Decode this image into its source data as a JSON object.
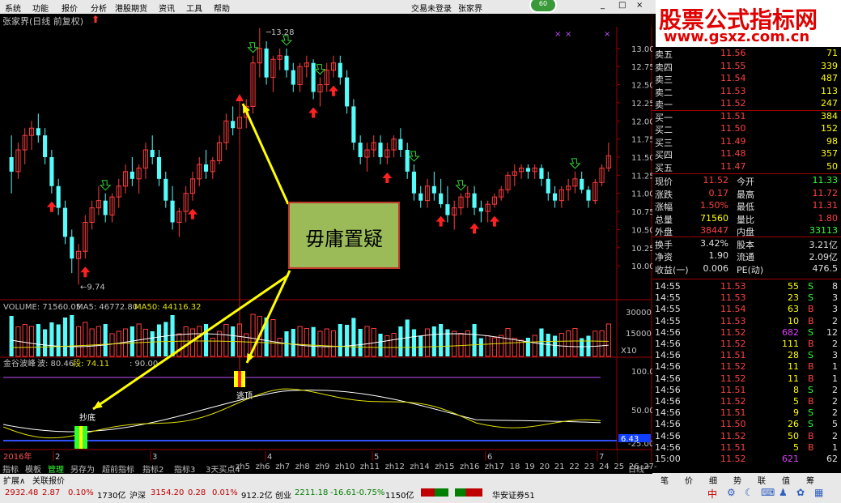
{
  "menu": [
    "系统",
    "功能",
    "报价",
    "分析",
    "港股期货",
    "资讯",
    "工具",
    "帮助"
  ],
  "top_status": {
    "trading": "交易未登录",
    "stock": "张家界",
    "badge": "60"
  },
  "window_buttons": [
    "_",
    "□",
    "×"
  ],
  "title": "张家界(日线 前复权)",
  "chart_data": {
    "type": "candlestick",
    "price_axis": {
      "ticks": [
        "13.00",
        "12.75",
        "12.50",
        "12.25",
        "12.00",
        "11.75",
        "11.50",
        "11.25",
        "11.00",
        "10.75",
        "10.50",
        "10.25",
        "10.00"
      ],
      "ylim": [
        9.7,
        13.3
      ]
    },
    "high_label": "13.28",
    "low_label": "9.74",
    "candles": [
      [
        11.5,
        11.8,
        11.0,
        11.3
      ],
      [
        11.3,
        11.7,
        11.2,
        11.6
      ],
      [
        11.6,
        11.9,
        11.4,
        11.8
      ],
      [
        11.8,
        12.0,
        11.6,
        11.9
      ],
      [
        11.9,
        12.1,
        11.7,
        11.8
      ],
      [
        11.8,
        11.9,
        11.4,
        11.5
      ],
      [
        11.5,
        11.6,
        11.0,
        11.1
      ],
      [
        11.1,
        11.2,
        10.7,
        10.8
      ],
      [
        10.8,
        10.9,
        10.3,
        10.4
      ],
      [
        10.4,
        10.5,
        9.9,
        10.1
      ],
      [
        10.1,
        10.3,
        9.74,
        10.2
      ],
      [
        10.2,
        10.7,
        10.1,
        10.6
      ],
      [
        10.6,
        10.9,
        10.5,
        10.8
      ],
      [
        10.8,
        11.1,
        10.7,
        10.9
      ],
      [
        10.9,
        11.0,
        10.6,
        10.7
      ],
      [
        10.7,
        11.0,
        10.6,
        10.95
      ],
      [
        10.95,
        11.2,
        10.8,
        11.1
      ],
      [
        11.1,
        11.4,
        11.0,
        11.3
      ],
      [
        11.3,
        11.5,
        11.1,
        11.2
      ],
      [
        11.2,
        11.4,
        11.0,
        11.35
      ],
      [
        11.35,
        11.7,
        11.2,
        11.6
      ],
      [
        11.6,
        11.8,
        11.4,
        11.5
      ],
      [
        11.5,
        11.6,
        11.1,
        11.2
      ],
      [
        11.2,
        11.3,
        10.8,
        10.9
      ],
      [
        10.9,
        11.1,
        10.5,
        10.6
      ],
      [
        10.6,
        10.8,
        10.4,
        10.75
      ],
      [
        10.75,
        11.1,
        10.6,
        11.0
      ],
      [
        11.0,
        11.3,
        10.9,
        11.2
      ],
      [
        11.2,
        11.5,
        11.1,
        11.4
      ],
      [
        11.4,
        11.6,
        11.2,
        11.3
      ],
      [
        11.3,
        11.5,
        11.2,
        11.45
      ],
      [
        11.45,
        11.8,
        11.4,
        11.7
      ],
      [
        11.7,
        12.1,
        11.6,
        12.0
      ],
      [
        12.0,
        12.2,
        11.8,
        11.9
      ],
      [
        11.9,
        12.1,
        11.7,
        12.05
      ],
      [
        12.05,
        12.3,
        11.9,
        12.2
      ],
      [
        12.2,
        12.9,
        12.1,
        12.8
      ],
      [
        12.8,
        13.28,
        12.6,
        13.0
      ],
      [
        13.0,
        13.1,
        12.5,
        12.6
      ],
      [
        12.6,
        12.9,
        12.4,
        12.85
      ],
      [
        12.85,
        13.0,
        12.7,
        12.9
      ],
      [
        12.9,
        13.0,
        12.6,
        12.7
      ],
      [
        12.7,
        12.8,
        12.4,
        12.5
      ],
      [
        12.5,
        12.8,
        12.4,
        12.75
      ],
      [
        12.75,
        12.9,
        12.6,
        12.8
      ],
      [
        12.8,
        12.85,
        12.3,
        12.4
      ],
      [
        12.4,
        12.6,
        12.2,
        12.5
      ],
      [
        12.5,
        12.8,
        12.4,
        12.7
      ],
      [
        12.7,
        12.9,
        12.6,
        12.8
      ],
      [
        12.8,
        12.9,
        12.5,
        12.6
      ],
      [
        12.6,
        12.7,
        12.1,
        12.2
      ],
      [
        12.2,
        12.3,
        11.6,
        11.7
      ],
      [
        11.7,
        11.8,
        11.4,
        11.5
      ],
      [
        11.5,
        11.7,
        11.3,
        11.6
      ],
      [
        11.6,
        11.8,
        11.5,
        11.7
      ],
      [
        11.7,
        11.8,
        11.4,
        11.5
      ],
      [
        11.5,
        11.7,
        11.4,
        11.6
      ],
      [
        11.6,
        11.8,
        11.5,
        11.75
      ],
      [
        11.75,
        11.9,
        11.5,
        11.6
      ],
      [
        11.6,
        11.7,
        11.2,
        11.3
      ],
      [
        11.3,
        11.4,
        10.9,
        11.0
      ],
      [
        11.0,
        11.1,
        10.8,
        10.9
      ],
      [
        10.9,
        11.2,
        10.8,
        11.1
      ],
      [
        11.1,
        11.3,
        10.9,
        11.0
      ],
      [
        11.0,
        11.2,
        10.8,
        10.85
      ],
      [
        10.85,
        11.1,
        10.6,
        10.7
      ],
      [
        10.7,
        10.9,
        10.5,
        10.8
      ],
      [
        10.8,
        11.0,
        10.7,
        10.95
      ],
      [
        10.95,
        11.1,
        10.8,
        11.0
      ],
      [
        11.0,
        11.1,
        10.7,
        10.8
      ],
      [
        10.8,
        10.9,
        10.6,
        10.75
      ],
      [
        10.75,
        10.9,
        10.6,
        10.85
      ],
      [
        10.85,
        11.0,
        10.8,
        10.95
      ],
      [
        10.95,
        11.1,
        10.9,
        11.05
      ],
      [
        11.05,
        11.3,
        11.0,
        11.25
      ],
      [
        11.25,
        11.4,
        11.1,
        11.3
      ],
      [
        11.3,
        11.4,
        11.2,
        11.35
      ],
      [
        11.35,
        11.4,
        11.2,
        11.3
      ],
      [
        11.3,
        11.4,
        11.2,
        11.35
      ],
      [
        11.35,
        11.4,
        11.1,
        11.2
      ],
      [
        11.2,
        11.3,
        10.9,
        11.0
      ],
      [
        11.0,
        11.1,
        10.8,
        10.9
      ],
      [
        10.9,
        11.1,
        10.8,
        11.05
      ],
      [
        11.05,
        11.2,
        10.9,
        11.1
      ],
      [
        11.1,
        11.3,
        11.0,
        11.2
      ],
      [
        11.2,
        11.3,
        11.0,
        11.05
      ],
      [
        11.05,
        11.1,
        10.8,
        10.9
      ],
      [
        10.9,
        11.2,
        10.85,
        11.15
      ],
      [
        11.15,
        11.4,
        11.1,
        11.35
      ],
      [
        11.35,
        11.7,
        11.3,
        11.52
      ]
    ],
    "buy_arrow_idx": [
      6,
      11,
      27,
      45,
      48,
      56,
      64,
      69,
      72
    ],
    "sell_mark_idx": [
      14,
      36,
      41,
      46,
      60,
      67,
      84
    ],
    "volume": {
      "label": "VOLUME: 71560.05",
      "ma5": "MA5: 46772.80",
      "ma50": "MA50: 44116.32",
      "ticks": [
        "30000",
        "15000"
      ],
      "unit": "X10"
    },
    "indicator": {
      "name": "金谷波峰",
      "bo": "波: 80.46",
      "duan": "段: 74.11",
      "v90": ": 90.00",
      "ticks": [
        "100.0",
        "50.00",
        "-25.00"
      ],
      "ref_value": "6.43",
      "bottom_label": "抄底",
      "top_label": "逃顶"
    },
    "date_axis": [
      "2016年",
      "2",
      "3",
      "4",
      "5",
      "6",
      "7"
    ]
  },
  "callout": "毋庸置疑",
  "watermark": {
    "title": "股票公式指标网",
    "url": "www.gsxz.com.cn"
  },
  "order_book": [
    {
      "label": "卖五",
      "price": "11.56",
      "vol": "71"
    },
    {
      "label": "卖四",
      "price": "11.55",
      "vol": "339"
    },
    {
      "label": "卖三",
      "price": "11.54",
      "vol": "487"
    },
    {
      "label": "卖二",
      "price": "11.53",
      "vol": "113"
    },
    {
      "label": "卖一",
      "price": "11.52",
      "vol": "247"
    },
    {
      "label": "买一",
      "price": "11.51",
      "vol": "384"
    },
    {
      "label": "买二",
      "price": "11.50",
      "vol": "152"
    },
    {
      "label": "买三",
      "price": "11.49",
      "vol": "98"
    },
    {
      "label": "买四",
      "price": "11.48",
      "vol": "357"
    },
    {
      "label": "买五",
      "price": "11.47",
      "vol": "50"
    }
  ],
  "stats": [
    {
      "k1": "现价",
      "v1": "11.52",
      "k2": "今开",
      "v2": "11.33"
    },
    {
      "k1": "涨跌",
      "v1": "0.17",
      "k2": "最高",
      "v2": "11.72"
    },
    {
      "k1": "涨幅",
      "v1": "1.50%",
      "k2": "最低",
      "v2": "11.31"
    },
    {
      "k1": "总量",
      "v1": "71560",
      "k2": "量比",
      "v2": "1.80"
    },
    {
      "k1": "外盘",
      "v1": "38447",
      "k2": "内盘",
      "v2": "33113"
    },
    {
      "k1": "换手",
      "v1": "3.42%",
      "k2": "股本",
      "v2": "3.21亿"
    },
    {
      "k1": "净资",
      "v1": "1.90",
      "k2": "流通",
      "v2": "2.09亿"
    },
    {
      "k1": "收益(一)",
      "v1": "0.006",
      "k2": "PE(动)",
      "v2": "476.5"
    }
  ],
  "ticks": [
    {
      "t": "14:55",
      "p": "11.53",
      "v": "55",
      "s": "S",
      "n": "8"
    },
    {
      "t": "14:55",
      "p": "11.53",
      "v": "23",
      "s": "S",
      "n": "3"
    },
    {
      "t": "14:55",
      "p": "11.54",
      "v": "63",
      "s": "B",
      "n": "3"
    },
    {
      "t": "14:55",
      "p": "11.53",
      "v": "10",
      "s": "B",
      "n": "2"
    },
    {
      "t": "14:56",
      "p": "11.52",
      "v": "682",
      "s": "S",
      "n": "12"
    },
    {
      "t": "14:56",
      "p": "11.52",
      "v": "111",
      "s": "B",
      "n": "2"
    },
    {
      "t": "14:56",
      "p": "11.51",
      "v": "28",
      "s": "S",
      "n": "3"
    },
    {
      "t": "14:56",
      "p": "11.52",
      "v": "11",
      "s": "B",
      "n": "1"
    },
    {
      "t": "14:56",
      "p": "11.52",
      "v": "11",
      "s": "B",
      "n": "1"
    },
    {
      "t": "14:56",
      "p": "11.51",
      "v": "8",
      "s": "S",
      "n": "2"
    },
    {
      "t": "14:56",
      "p": "11.52",
      "v": "5",
      "s": "B",
      "n": "2"
    },
    {
      "t": "14:56",
      "p": "11.51",
      "v": "9",
      "s": "S",
      "n": "2"
    },
    {
      "t": "14:56",
      "p": "11.50",
      "v": "26",
      "s": "S",
      "n": "5"
    },
    {
      "t": "14:56",
      "p": "11.52",
      "v": "50",
      "s": "B",
      "n": "2"
    },
    {
      "t": "14:56",
      "p": "11.51",
      "v": "5",
      "s": "B",
      "n": "1"
    },
    {
      "t": "15:00",
      "p": "11.52",
      "v": "621",
      "s": "",
      "n": "62"
    }
  ],
  "tabs": [
    "指标",
    "模板",
    "管理",
    "另存为",
    "超前指标",
    "指标2",
    "指标3",
    "3天买点4",
    "zh5",
    "zh6",
    "zh7",
    "zh8",
    "zh9",
    "zh10",
    "zh11",
    "zh12",
    "zh14",
    "zh15",
    "zh16",
    "zh17",
    "18",
    "19",
    "20",
    "21",
    "22",
    "23",
    "24",
    "25",
    "26",
    "27",
    "日线",
    "+",
    "-"
  ],
  "tabs2": [
    "扩展∧",
    "关联报价"
  ],
  "right_tools": [
    "笔",
    "价",
    "细",
    "势",
    "联",
    "值",
    "筹"
  ],
  "status": {
    "idx1": "2932.48",
    "chg1": "2.87",
    "pct1": "0.10%",
    "amt1": "1730亿",
    "name2": "沪深",
    "idx2": "3154.20",
    "chg2": "0.28",
    "pct2": "0.01%",
    "amt2": "912.2亿",
    "name3": "创业",
    "idx3": "2211.18",
    "chg3": "-16.61",
    "pct3": "-0.75%",
    "amt3": "1150亿",
    "broker": "华安证券51",
    "ime": "中"
  }
}
